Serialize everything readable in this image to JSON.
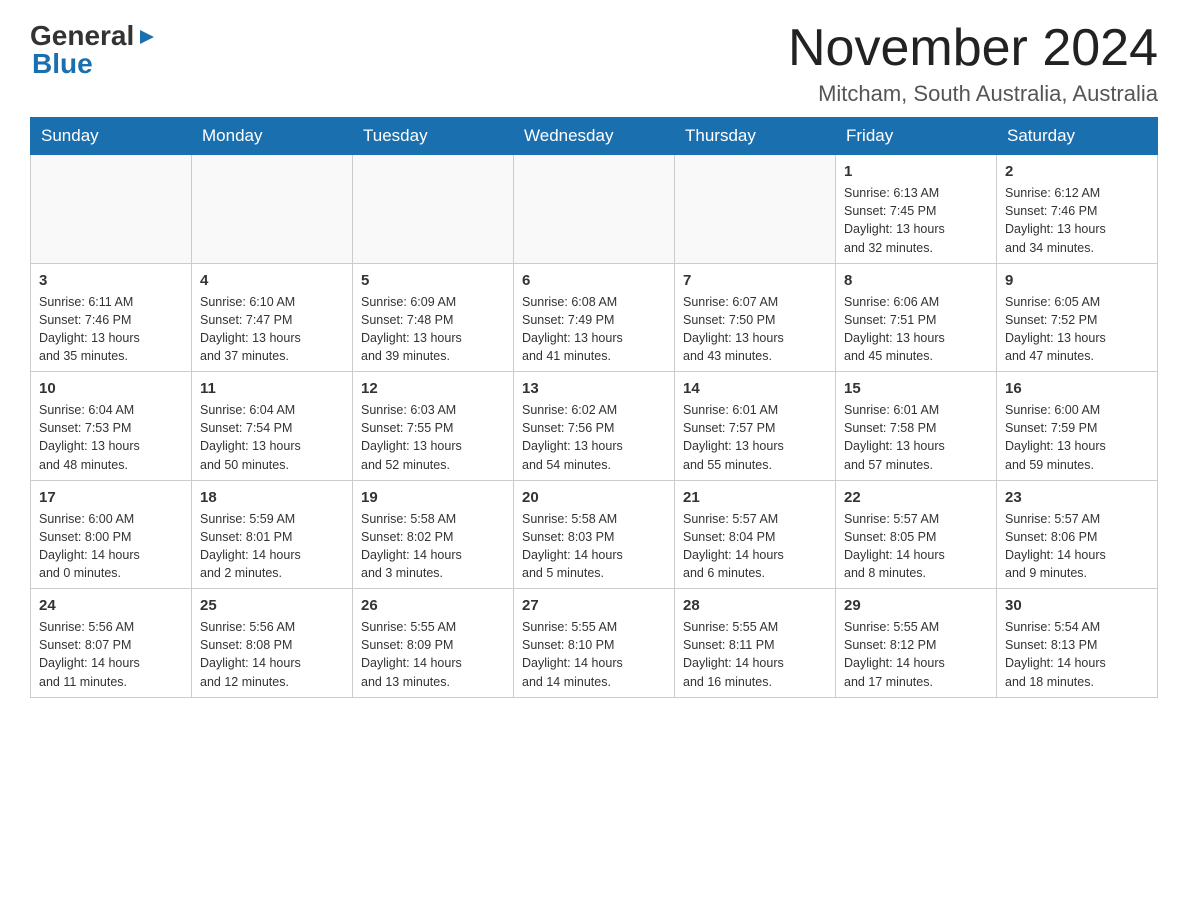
{
  "header": {
    "logo_general": "General",
    "logo_blue": "Blue",
    "month_title": "November 2024",
    "location": "Mitcham, South Australia, Australia"
  },
  "calendar": {
    "days": [
      "Sunday",
      "Monday",
      "Tuesday",
      "Wednesday",
      "Thursday",
      "Friday",
      "Saturday"
    ],
    "weeks": [
      [
        {
          "day": "",
          "info": ""
        },
        {
          "day": "",
          "info": ""
        },
        {
          "day": "",
          "info": ""
        },
        {
          "day": "",
          "info": ""
        },
        {
          "day": "",
          "info": ""
        },
        {
          "day": "1",
          "info": "Sunrise: 6:13 AM\nSunset: 7:45 PM\nDaylight: 13 hours\nand 32 minutes."
        },
        {
          "day": "2",
          "info": "Sunrise: 6:12 AM\nSunset: 7:46 PM\nDaylight: 13 hours\nand 34 minutes."
        }
      ],
      [
        {
          "day": "3",
          "info": "Sunrise: 6:11 AM\nSunset: 7:46 PM\nDaylight: 13 hours\nand 35 minutes."
        },
        {
          "day": "4",
          "info": "Sunrise: 6:10 AM\nSunset: 7:47 PM\nDaylight: 13 hours\nand 37 minutes."
        },
        {
          "day": "5",
          "info": "Sunrise: 6:09 AM\nSunset: 7:48 PM\nDaylight: 13 hours\nand 39 minutes."
        },
        {
          "day": "6",
          "info": "Sunrise: 6:08 AM\nSunset: 7:49 PM\nDaylight: 13 hours\nand 41 minutes."
        },
        {
          "day": "7",
          "info": "Sunrise: 6:07 AM\nSunset: 7:50 PM\nDaylight: 13 hours\nand 43 minutes."
        },
        {
          "day": "8",
          "info": "Sunrise: 6:06 AM\nSunset: 7:51 PM\nDaylight: 13 hours\nand 45 minutes."
        },
        {
          "day": "9",
          "info": "Sunrise: 6:05 AM\nSunset: 7:52 PM\nDaylight: 13 hours\nand 47 minutes."
        }
      ],
      [
        {
          "day": "10",
          "info": "Sunrise: 6:04 AM\nSunset: 7:53 PM\nDaylight: 13 hours\nand 48 minutes."
        },
        {
          "day": "11",
          "info": "Sunrise: 6:04 AM\nSunset: 7:54 PM\nDaylight: 13 hours\nand 50 minutes."
        },
        {
          "day": "12",
          "info": "Sunrise: 6:03 AM\nSunset: 7:55 PM\nDaylight: 13 hours\nand 52 minutes."
        },
        {
          "day": "13",
          "info": "Sunrise: 6:02 AM\nSunset: 7:56 PM\nDaylight: 13 hours\nand 54 minutes."
        },
        {
          "day": "14",
          "info": "Sunrise: 6:01 AM\nSunset: 7:57 PM\nDaylight: 13 hours\nand 55 minutes."
        },
        {
          "day": "15",
          "info": "Sunrise: 6:01 AM\nSunset: 7:58 PM\nDaylight: 13 hours\nand 57 minutes."
        },
        {
          "day": "16",
          "info": "Sunrise: 6:00 AM\nSunset: 7:59 PM\nDaylight: 13 hours\nand 59 minutes."
        }
      ],
      [
        {
          "day": "17",
          "info": "Sunrise: 6:00 AM\nSunset: 8:00 PM\nDaylight: 14 hours\nand 0 minutes."
        },
        {
          "day": "18",
          "info": "Sunrise: 5:59 AM\nSunset: 8:01 PM\nDaylight: 14 hours\nand 2 minutes."
        },
        {
          "day": "19",
          "info": "Sunrise: 5:58 AM\nSunset: 8:02 PM\nDaylight: 14 hours\nand 3 minutes."
        },
        {
          "day": "20",
          "info": "Sunrise: 5:58 AM\nSunset: 8:03 PM\nDaylight: 14 hours\nand 5 minutes."
        },
        {
          "day": "21",
          "info": "Sunrise: 5:57 AM\nSunset: 8:04 PM\nDaylight: 14 hours\nand 6 minutes."
        },
        {
          "day": "22",
          "info": "Sunrise: 5:57 AM\nSunset: 8:05 PM\nDaylight: 14 hours\nand 8 minutes."
        },
        {
          "day": "23",
          "info": "Sunrise: 5:57 AM\nSunset: 8:06 PM\nDaylight: 14 hours\nand 9 minutes."
        }
      ],
      [
        {
          "day": "24",
          "info": "Sunrise: 5:56 AM\nSunset: 8:07 PM\nDaylight: 14 hours\nand 11 minutes."
        },
        {
          "day": "25",
          "info": "Sunrise: 5:56 AM\nSunset: 8:08 PM\nDaylight: 14 hours\nand 12 minutes."
        },
        {
          "day": "26",
          "info": "Sunrise: 5:55 AM\nSunset: 8:09 PM\nDaylight: 14 hours\nand 13 minutes."
        },
        {
          "day": "27",
          "info": "Sunrise: 5:55 AM\nSunset: 8:10 PM\nDaylight: 14 hours\nand 14 minutes."
        },
        {
          "day": "28",
          "info": "Sunrise: 5:55 AM\nSunset: 8:11 PM\nDaylight: 14 hours\nand 16 minutes."
        },
        {
          "day": "29",
          "info": "Sunrise: 5:55 AM\nSunset: 8:12 PM\nDaylight: 14 hours\nand 17 minutes."
        },
        {
          "day": "30",
          "info": "Sunrise: 5:54 AM\nSunset: 8:13 PM\nDaylight: 14 hours\nand 18 minutes."
        }
      ]
    ]
  }
}
